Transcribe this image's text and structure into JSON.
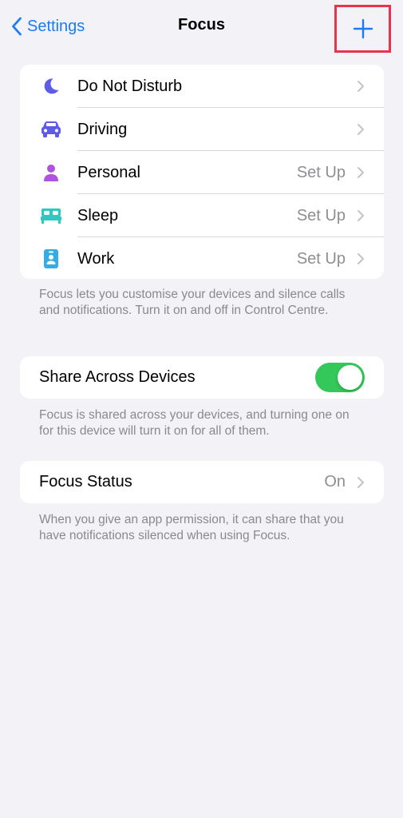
{
  "nav": {
    "back_label": "Settings",
    "title": "Focus",
    "add_icon": "plus-icon",
    "accent_color": "#1a7cf5",
    "highlight_color": "#e8344a"
  },
  "focus_modes": [
    {
      "label": "Do Not Disturb",
      "value": "",
      "icon": "moon-icon",
      "icon_color": "#5e5ce6"
    },
    {
      "label": "Driving",
      "value": "",
      "icon": "car-icon",
      "icon_color": "#5e5ce6"
    },
    {
      "label": "Personal",
      "value": "Set Up",
      "icon": "person-icon",
      "icon_color": "#af52de"
    },
    {
      "label": "Sleep",
      "value": "Set Up",
      "icon": "bed-icon",
      "icon_color": "#30c8be"
    },
    {
      "label": "Work",
      "value": "Set Up",
      "icon": "id-badge-icon",
      "icon_color": "#32ade6"
    }
  ],
  "focus_footnote": "Focus lets you customise your devices and silence calls and notifications. Turn it on and off in Control Centre.",
  "share": {
    "label": "Share Across Devices",
    "enabled": true,
    "toggle_color": "#34c759",
    "footnote": "Focus is shared across your devices, and turning one on for this device will turn it on for all of them."
  },
  "status": {
    "label": "Focus Status",
    "value": "On",
    "footnote": "When you give an app permission, it can share that you have notifications silenced when using Focus."
  }
}
